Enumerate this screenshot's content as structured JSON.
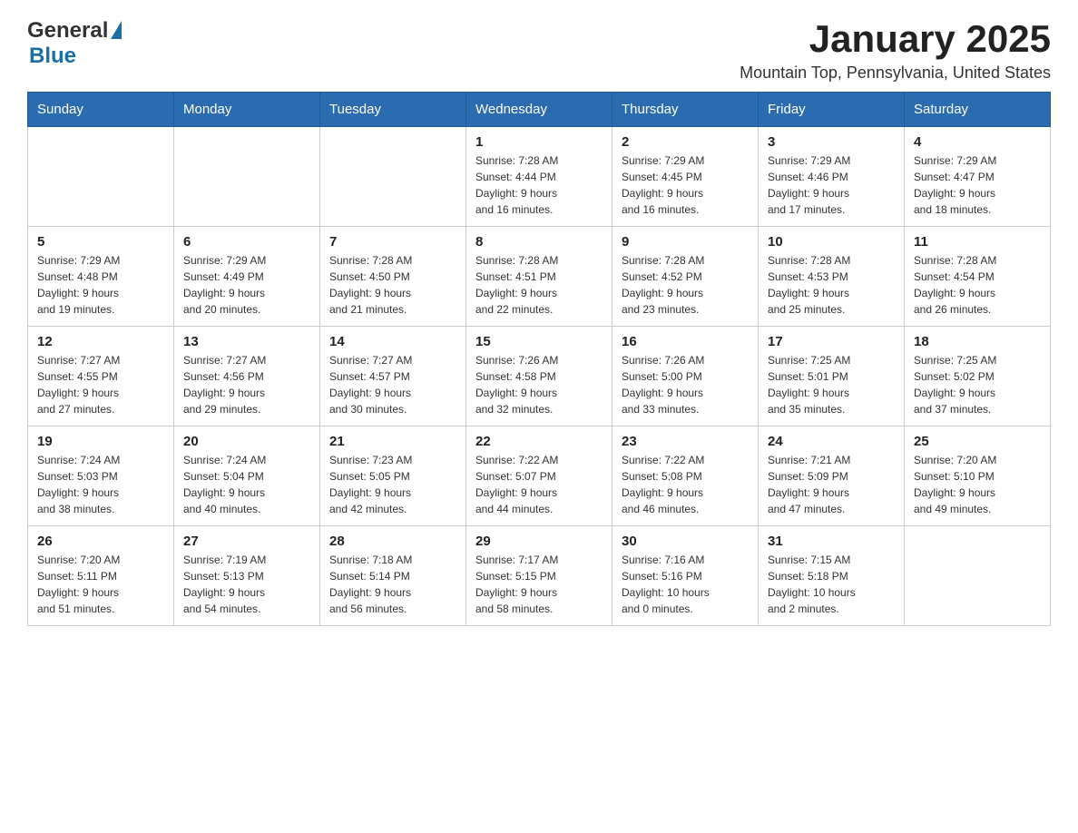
{
  "header": {
    "logo_general": "General",
    "logo_blue": "Blue",
    "title": "January 2025",
    "subtitle": "Mountain Top, Pennsylvania, United States"
  },
  "days_of_week": [
    "Sunday",
    "Monday",
    "Tuesday",
    "Wednesday",
    "Thursday",
    "Friday",
    "Saturday"
  ],
  "weeks": [
    [
      {
        "day": "",
        "info": ""
      },
      {
        "day": "",
        "info": ""
      },
      {
        "day": "",
        "info": ""
      },
      {
        "day": "1",
        "info": "Sunrise: 7:28 AM\nSunset: 4:44 PM\nDaylight: 9 hours\nand 16 minutes."
      },
      {
        "day": "2",
        "info": "Sunrise: 7:29 AM\nSunset: 4:45 PM\nDaylight: 9 hours\nand 16 minutes."
      },
      {
        "day": "3",
        "info": "Sunrise: 7:29 AM\nSunset: 4:46 PM\nDaylight: 9 hours\nand 17 minutes."
      },
      {
        "day": "4",
        "info": "Sunrise: 7:29 AM\nSunset: 4:47 PM\nDaylight: 9 hours\nand 18 minutes."
      }
    ],
    [
      {
        "day": "5",
        "info": "Sunrise: 7:29 AM\nSunset: 4:48 PM\nDaylight: 9 hours\nand 19 minutes."
      },
      {
        "day": "6",
        "info": "Sunrise: 7:29 AM\nSunset: 4:49 PM\nDaylight: 9 hours\nand 20 minutes."
      },
      {
        "day": "7",
        "info": "Sunrise: 7:28 AM\nSunset: 4:50 PM\nDaylight: 9 hours\nand 21 minutes."
      },
      {
        "day": "8",
        "info": "Sunrise: 7:28 AM\nSunset: 4:51 PM\nDaylight: 9 hours\nand 22 minutes."
      },
      {
        "day": "9",
        "info": "Sunrise: 7:28 AM\nSunset: 4:52 PM\nDaylight: 9 hours\nand 23 minutes."
      },
      {
        "day": "10",
        "info": "Sunrise: 7:28 AM\nSunset: 4:53 PM\nDaylight: 9 hours\nand 25 minutes."
      },
      {
        "day": "11",
        "info": "Sunrise: 7:28 AM\nSunset: 4:54 PM\nDaylight: 9 hours\nand 26 minutes."
      }
    ],
    [
      {
        "day": "12",
        "info": "Sunrise: 7:27 AM\nSunset: 4:55 PM\nDaylight: 9 hours\nand 27 minutes."
      },
      {
        "day": "13",
        "info": "Sunrise: 7:27 AM\nSunset: 4:56 PM\nDaylight: 9 hours\nand 29 minutes."
      },
      {
        "day": "14",
        "info": "Sunrise: 7:27 AM\nSunset: 4:57 PM\nDaylight: 9 hours\nand 30 minutes."
      },
      {
        "day": "15",
        "info": "Sunrise: 7:26 AM\nSunset: 4:58 PM\nDaylight: 9 hours\nand 32 minutes."
      },
      {
        "day": "16",
        "info": "Sunrise: 7:26 AM\nSunset: 5:00 PM\nDaylight: 9 hours\nand 33 minutes."
      },
      {
        "day": "17",
        "info": "Sunrise: 7:25 AM\nSunset: 5:01 PM\nDaylight: 9 hours\nand 35 minutes."
      },
      {
        "day": "18",
        "info": "Sunrise: 7:25 AM\nSunset: 5:02 PM\nDaylight: 9 hours\nand 37 minutes."
      }
    ],
    [
      {
        "day": "19",
        "info": "Sunrise: 7:24 AM\nSunset: 5:03 PM\nDaylight: 9 hours\nand 38 minutes."
      },
      {
        "day": "20",
        "info": "Sunrise: 7:24 AM\nSunset: 5:04 PM\nDaylight: 9 hours\nand 40 minutes."
      },
      {
        "day": "21",
        "info": "Sunrise: 7:23 AM\nSunset: 5:05 PM\nDaylight: 9 hours\nand 42 minutes."
      },
      {
        "day": "22",
        "info": "Sunrise: 7:22 AM\nSunset: 5:07 PM\nDaylight: 9 hours\nand 44 minutes."
      },
      {
        "day": "23",
        "info": "Sunrise: 7:22 AM\nSunset: 5:08 PM\nDaylight: 9 hours\nand 46 minutes."
      },
      {
        "day": "24",
        "info": "Sunrise: 7:21 AM\nSunset: 5:09 PM\nDaylight: 9 hours\nand 47 minutes."
      },
      {
        "day": "25",
        "info": "Sunrise: 7:20 AM\nSunset: 5:10 PM\nDaylight: 9 hours\nand 49 minutes."
      }
    ],
    [
      {
        "day": "26",
        "info": "Sunrise: 7:20 AM\nSunset: 5:11 PM\nDaylight: 9 hours\nand 51 minutes."
      },
      {
        "day": "27",
        "info": "Sunrise: 7:19 AM\nSunset: 5:13 PM\nDaylight: 9 hours\nand 54 minutes."
      },
      {
        "day": "28",
        "info": "Sunrise: 7:18 AM\nSunset: 5:14 PM\nDaylight: 9 hours\nand 56 minutes."
      },
      {
        "day": "29",
        "info": "Sunrise: 7:17 AM\nSunset: 5:15 PM\nDaylight: 9 hours\nand 58 minutes."
      },
      {
        "day": "30",
        "info": "Sunrise: 7:16 AM\nSunset: 5:16 PM\nDaylight: 10 hours\nand 0 minutes."
      },
      {
        "day": "31",
        "info": "Sunrise: 7:15 AM\nSunset: 5:18 PM\nDaylight: 10 hours\nand 2 minutes."
      },
      {
        "day": "",
        "info": ""
      }
    ]
  ]
}
